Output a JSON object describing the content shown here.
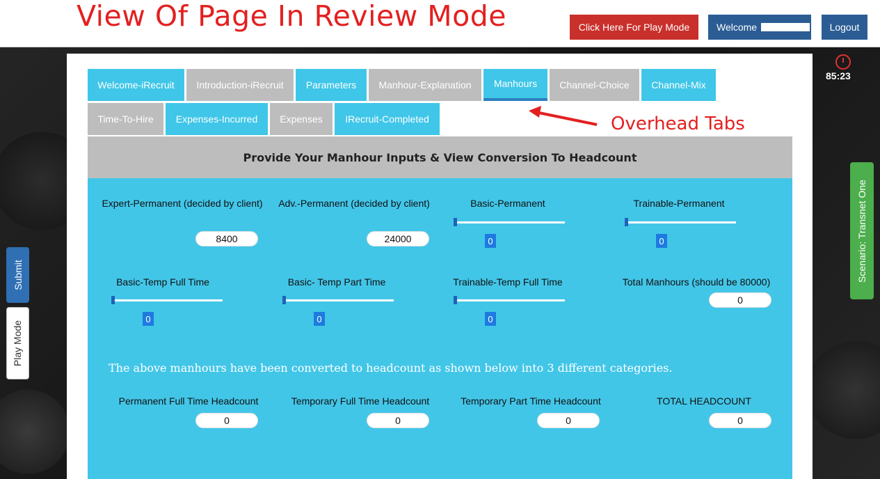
{
  "header": {
    "review_title": "View  Of Page In Review Mode",
    "play_mode_button": "Click Here For Play Mode",
    "welcome_button": "Welcome",
    "logout_button": "Logout"
  },
  "timer": {
    "value": "85:23"
  },
  "side": {
    "submit": "Submit",
    "play_mode": "Play Mode",
    "scenario": "Scenario: Transnet One"
  },
  "tabs": [
    {
      "label": "Welcome-iRecruit",
      "style": "cyan"
    },
    {
      "label": "Introduction-iRecruit",
      "style": "grey"
    },
    {
      "label": "Parameters",
      "style": "cyan"
    },
    {
      "label": "Manhour-Explanation",
      "style": "grey"
    },
    {
      "label": "Manhours",
      "style": "cyan",
      "active": true
    },
    {
      "label": "Channel-Choice",
      "style": "grey"
    },
    {
      "label": "Channel-Mix",
      "style": "cyan"
    },
    {
      "label": "Time-To-Hire",
      "style": "grey"
    },
    {
      "label": "Expenses-Incurred",
      "style": "cyan"
    },
    {
      "label": "Expenses",
      "style": "grey"
    },
    {
      "label": "IRecruit-Completed",
      "style": "cyan"
    }
  ],
  "annotation": {
    "overhead_tabs": "Overhead Tabs"
  },
  "section_title": "Provide Your Manhour Inputs & View Conversion To Headcount",
  "inputs": {
    "expert_permanent": {
      "label": "Expert-Permanent (decided by client)",
      "value": "8400"
    },
    "adv_permanent": {
      "label": "Adv.-Permanent (decided by client)",
      "value": "24000"
    },
    "basic_permanent": {
      "label": "Basic-Permanent",
      "value": "0"
    },
    "trainable_permanent": {
      "label": "Trainable-Permanent",
      "value": "0"
    },
    "basic_temp_full": {
      "label": "Basic-Temp Full Time",
      "value": "0"
    },
    "basic_temp_part": {
      "label": "Basic- Temp Part Time",
      "value": "0"
    },
    "trainable_temp_full": {
      "label": "Trainable-Temp Full Time",
      "value": "0"
    },
    "total_manhours": {
      "label": "Total Manhours (should be 80000)",
      "value": "0"
    }
  },
  "note": "The above manhours have been converted to headcount as shown below into 3 different categories.",
  "headcount": {
    "permanent_full": {
      "label": "Permanent Full Time Headcount",
      "value": "0"
    },
    "temporary_full": {
      "label": "Temporary Full Time Headcount",
      "value": "0"
    },
    "temporary_part": {
      "label": "Temporary Part Time Headcount",
      "value": "0"
    },
    "total": {
      "label": "TOTAL HEADCOUNT",
      "value": "0"
    }
  },
  "colors": {
    "panel": "#42c6e8",
    "tab_cyan": "#3fc6e8",
    "tab_grey": "#bdbdbd",
    "annotation_red": "#e32020",
    "play_button": "#c9302c",
    "nav_button": "#2b5d94",
    "scenario_green": "#4cae4c"
  },
  "icons": {
    "timer": "stopwatch-icon",
    "arrow": "arrow-left-icon"
  }
}
